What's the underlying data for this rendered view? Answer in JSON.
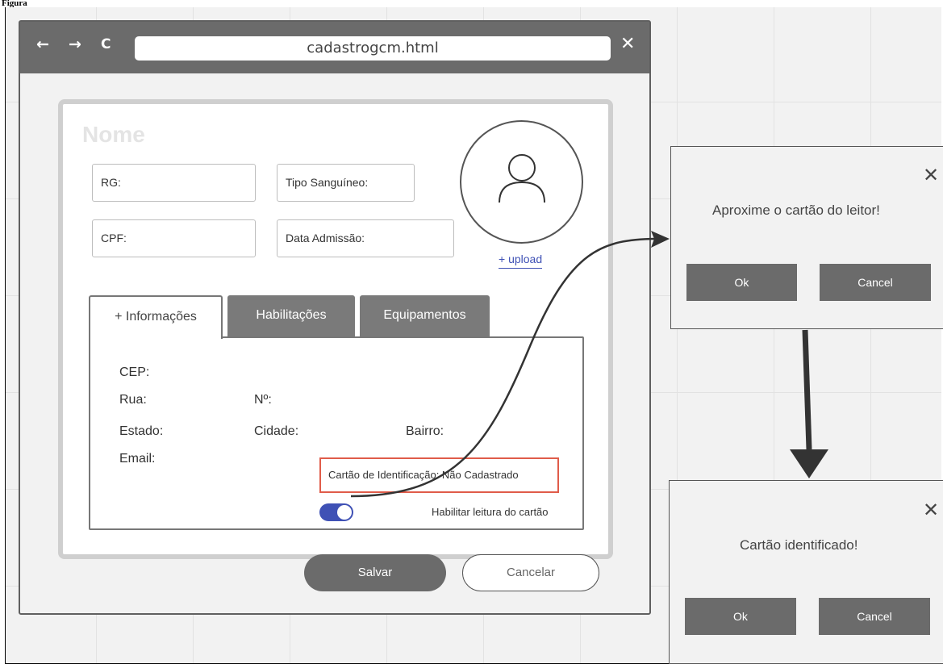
{
  "caption": "Figura",
  "browser": {
    "back_icon": "←",
    "forward_icon": "→",
    "reload_icon": "C",
    "url": "cadastrogcm.html",
    "close_icon": "✕"
  },
  "form": {
    "name_placeholder": "Nome",
    "fields": {
      "rg": "RG:",
      "tipo_sanguineo": "Tipo Sanguíneo:",
      "cpf": "CPF:",
      "data_admissao": "Data Admissão:"
    },
    "upload_label": "+ upload",
    "tabs": [
      "+ Informações",
      "Habilitações",
      "Equipamentos"
    ],
    "info": {
      "cep": "CEP:",
      "rua": "Rua:",
      "numero": "Nº:",
      "estado": "Estado:",
      "cidade": "Cidade:",
      "bairro": "Bairro:",
      "email": "Email:",
      "card_status": "Cartão de Identificação: Não Cadastrado",
      "toggle_label": "Habilitar leitura do cartão",
      "toggle_on": true
    },
    "save_label": "Salvar",
    "cancel_label": "Cancelar"
  },
  "dialog_read": {
    "message": "Aproxime o cartão do leitor!",
    "ok_label": "Ok",
    "cancel_label": "Cancel",
    "close_icon": "✕"
  },
  "dialog_identified": {
    "message": "Cartão identificado!",
    "ok_label": "Ok",
    "cancel_label": "Cancel",
    "close_icon": "✕"
  },
  "colors": {
    "toolbar": "#6b6b6b",
    "accent": "#3f51b5",
    "error_border": "#e05c4a"
  }
}
